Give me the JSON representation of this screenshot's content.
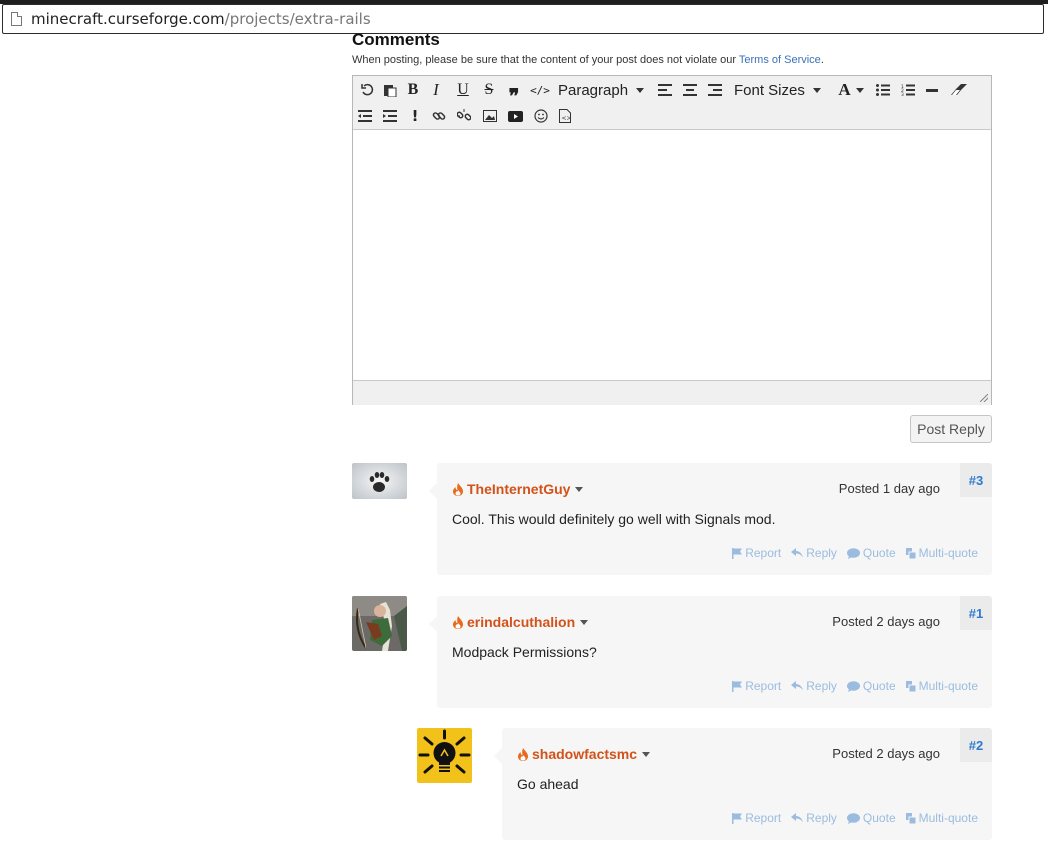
{
  "browser": {
    "url_host": "minecraft.curseforge.com",
    "url_path": "/projects/extra-rails"
  },
  "comments_section": {
    "title": "Comments",
    "notice_prefix": "When posting, please be sure that the content of your post does not violate our ",
    "notice_link": "Terms of Service",
    "notice_suffix": "."
  },
  "editor": {
    "toolbar": {
      "format_select": "Paragraph",
      "font_size_select": "Font Sizes",
      "icons": [
        "undo-icon",
        "paste-icon",
        "bold-icon",
        "italic-icon",
        "underline-icon",
        "strikethrough-icon",
        "blockquote-icon",
        "code-icon",
        "align-left-icon",
        "align-center-icon",
        "align-right-icon",
        "text-color-icon",
        "bullet-list-icon",
        "numbered-list-icon",
        "horizontal-rule-icon",
        "clear-format-icon",
        "outdent-icon",
        "indent-icon",
        "spoiler-icon",
        "link-icon",
        "unlink-icon",
        "image-icon",
        "video-icon",
        "emoticon-icon",
        "source-icon"
      ]
    },
    "submit_label": "Post Reply"
  },
  "accent_colors": {
    "username": "#d3521a",
    "comment_number": "#2e7ad1",
    "action_link": "#9bbcdf"
  },
  "comments": [
    {
      "username": "TheInternetGuy",
      "posted": "Posted 1 day ago",
      "number": "#3",
      "text": "Cool. This would definitely go well with Signals mod.",
      "avatar": "paw-print-avatar"
    },
    {
      "username": "erindalcuthalion",
      "posted": "Posted 2 days ago",
      "number": "#1",
      "text": "Modpack Permissions?",
      "avatar": "elf-archer-avatar"
    },
    {
      "username": "shadowfactsmc",
      "posted": "Posted 2 days ago",
      "number": "#2",
      "text": "Go ahead",
      "avatar": "lightbulb-avatar"
    }
  ],
  "comment_actions": {
    "report": "Report",
    "reply": "Reply",
    "quote": "Quote",
    "multiquote": "Multi-quote"
  }
}
